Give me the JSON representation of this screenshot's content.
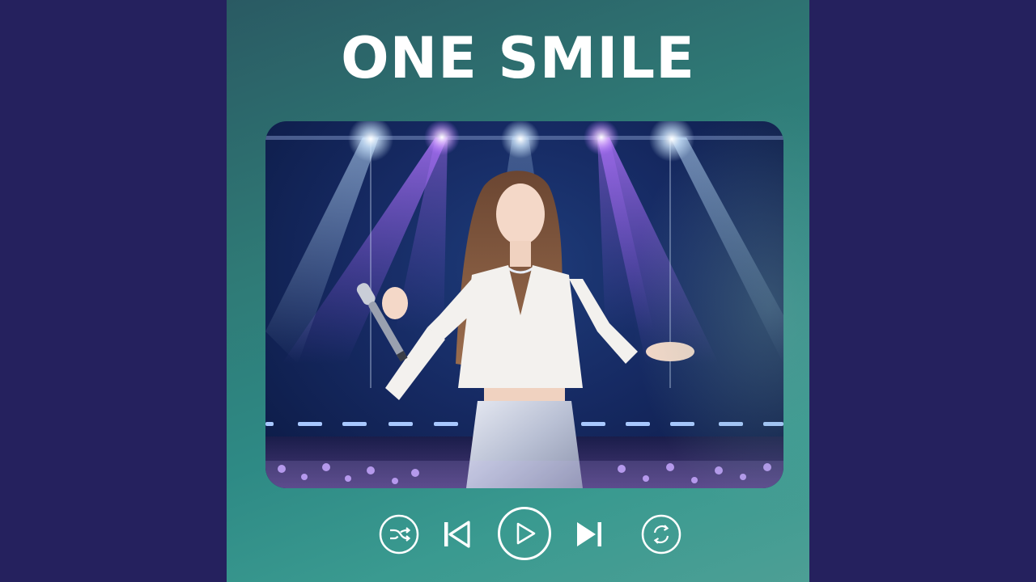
{
  "cover": {
    "title": "ONE SMILE"
  },
  "player": {
    "buttons": [
      {
        "name": "shuffle",
        "icon": "shuffle-icon"
      },
      {
        "name": "previous",
        "icon": "skip-previous-icon"
      },
      {
        "name": "play",
        "icon": "play-icon"
      },
      {
        "name": "next",
        "icon": "skip-next-icon"
      },
      {
        "name": "repeat",
        "icon": "repeat-icon"
      }
    ]
  },
  "colors": {
    "outer_background": "#25215e",
    "card_gradient_start": "#2a5a63",
    "card_gradient_end": "#4d9f95",
    "foreground": "#ffffff"
  }
}
